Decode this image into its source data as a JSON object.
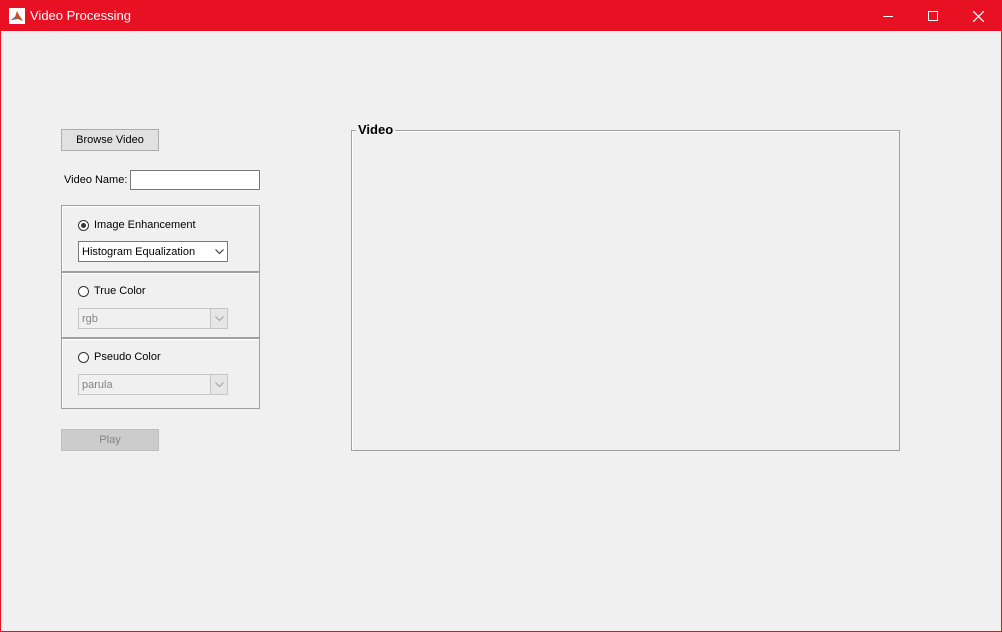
{
  "window": {
    "title": "Video Processing",
    "accent_color": "#e81123",
    "controls": [
      "minimize-icon",
      "maximize-icon",
      "close-icon"
    ]
  },
  "browse_button": {
    "label": "Browse Video"
  },
  "video_name": {
    "label": "Video Name:",
    "value": ""
  },
  "options": {
    "image_enhancement": {
      "label": "Image Enhancement",
      "checked": true,
      "selected": "Histogram Equalization",
      "enabled": true
    },
    "true_color": {
      "label": "True Color",
      "checked": false,
      "selected": "rgb",
      "enabled": false
    },
    "pseudo_color": {
      "label": "Pseudo Color",
      "checked": false,
      "selected": "parula",
      "enabled": false
    }
  },
  "play_button": {
    "label": "Play",
    "enabled": false
  },
  "video_panel": {
    "title": "Video"
  }
}
